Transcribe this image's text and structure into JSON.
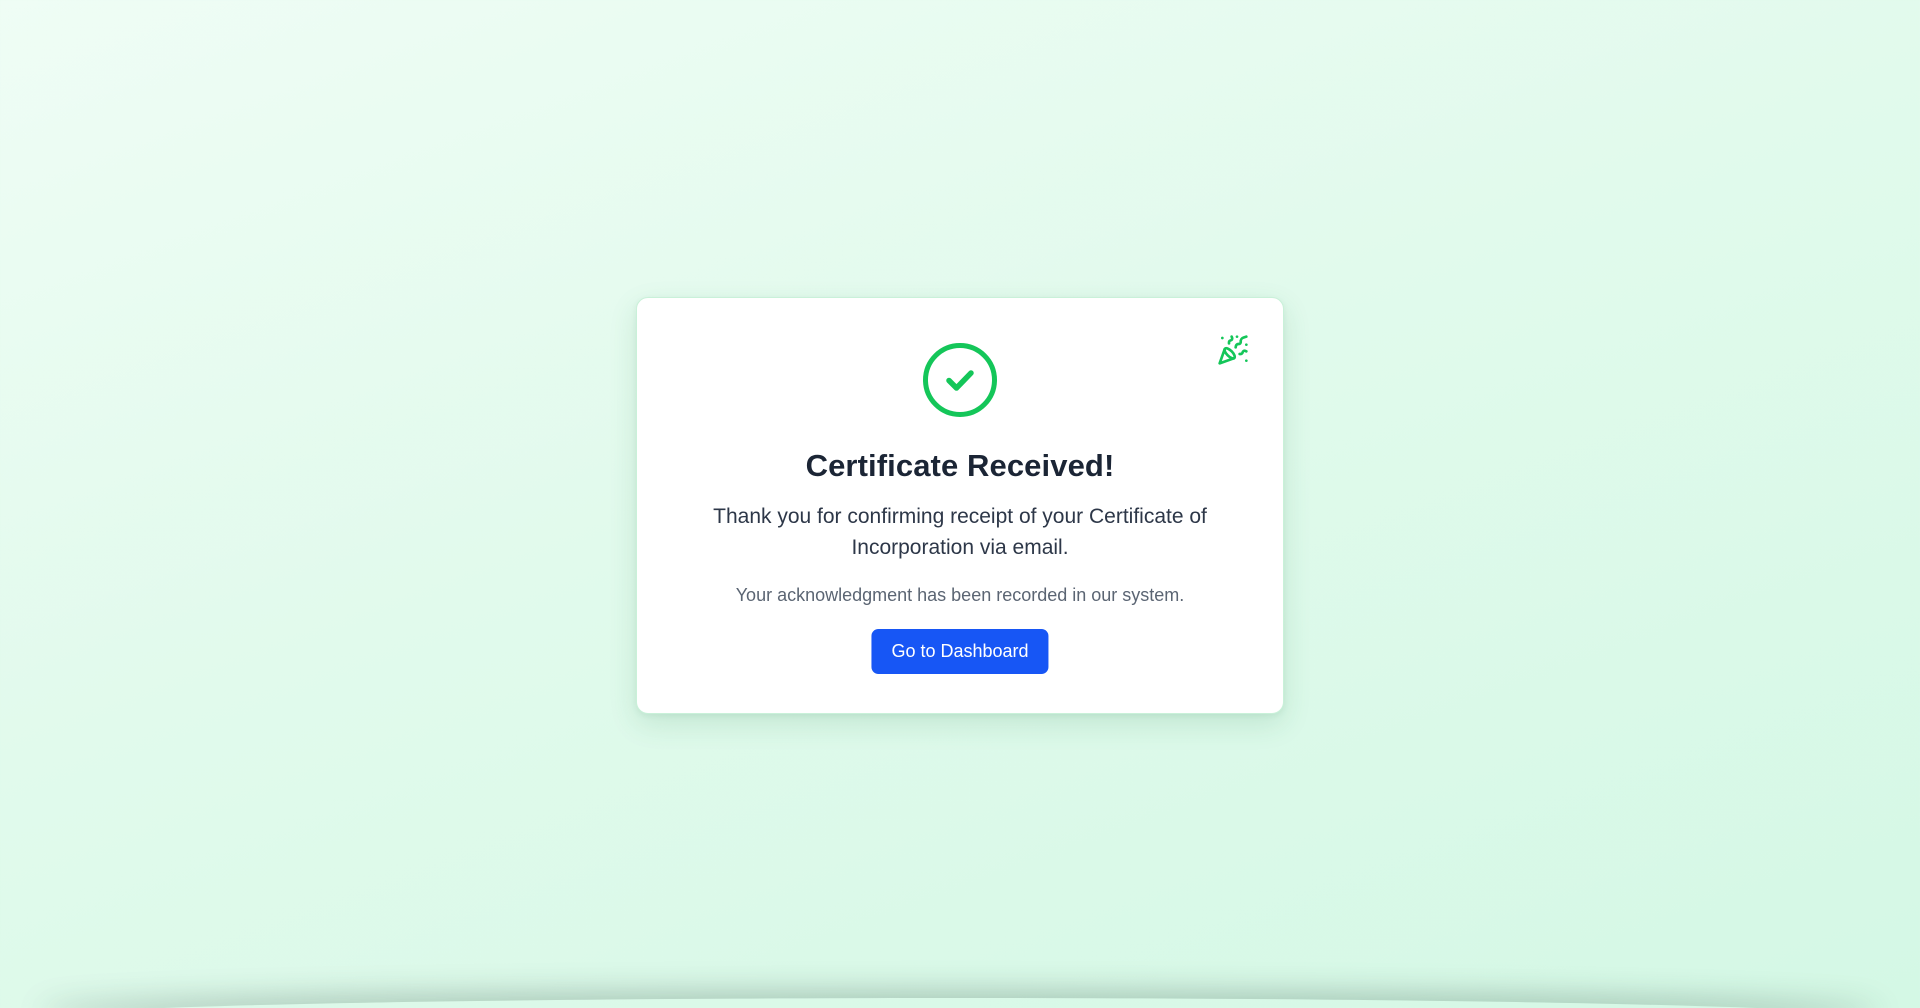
{
  "confirmation": {
    "title": "Certificate Received!",
    "message": "Thank you for confirming receipt of your Certificate of Incorporation via email.",
    "note": "Your acknowledgment has been recorded in our system.",
    "button_label": "Go to Dashboard"
  },
  "icons": {
    "status": "check-circle-icon",
    "decoration": "party-popper-icon"
  },
  "colors": {
    "success": "#14c659",
    "primary_button": "#1756f5",
    "title_text": "#1b2535",
    "background": "#e1faec"
  }
}
